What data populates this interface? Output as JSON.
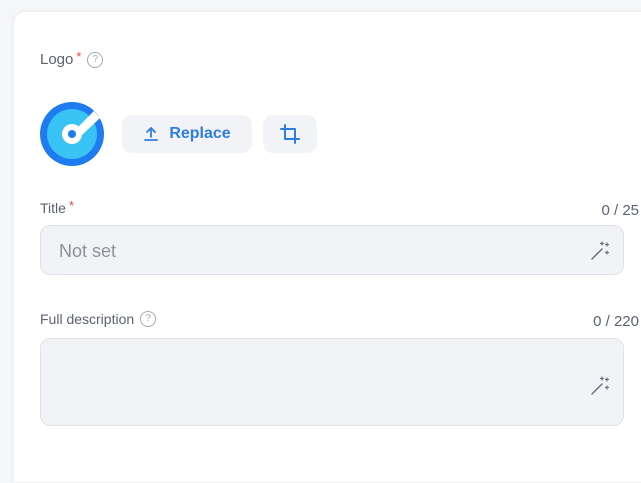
{
  "logo": {
    "label": "Logo",
    "required_mark": "*",
    "help_glyph": "?",
    "replace_label": "Replace",
    "icons": [
      "help-circle-icon",
      "app-logo-icon",
      "upload-icon",
      "crop-icon"
    ]
  },
  "title_field": {
    "label": "Title",
    "required_mark": "*",
    "counter": "0 / 25",
    "placeholder": "Not set",
    "value": "",
    "icon": "magic-wand-icon"
  },
  "description_field": {
    "label": "Full description",
    "help_glyph": "?",
    "counter": "0 / 220",
    "value": "",
    "icon": "magic-wand-icon"
  },
  "colors": {
    "accent": "#2f7de1",
    "required": "#e5484d",
    "logo_blue": "#1e7cf0",
    "logo_cyan": "#38c3f5"
  }
}
